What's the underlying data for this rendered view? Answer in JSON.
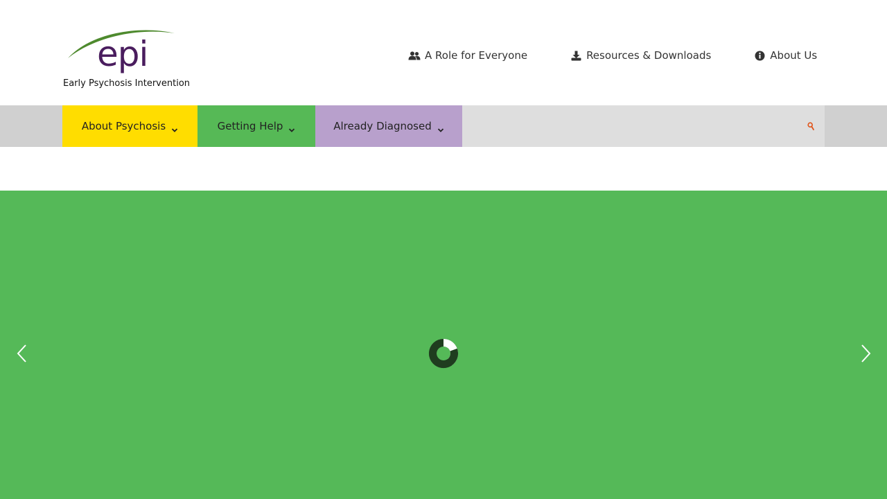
{
  "brand": {
    "logo_text": "epi",
    "tagline": "Early Psychosis Intervention",
    "logo_color": "#4a1d5e",
    "swoosh_color": "#4e8a2e"
  },
  "top_links": [
    {
      "label": "A Role for Everyone",
      "icon": "users-icon"
    },
    {
      "label": "Resources & Downloads",
      "icon": "download-icon"
    },
    {
      "label": "About Us",
      "icon": "info-icon"
    }
  ],
  "nav": {
    "items": [
      {
        "label": "About Psychosis",
        "color": "#ffdd00"
      },
      {
        "label": "Getting Help",
        "color": "#56b956"
      },
      {
        "label": "Already Diagnosed",
        "color": "#b8a0cc"
      }
    ],
    "search_icon": "search-icon",
    "search_color": "#e0541a"
  },
  "hero": {
    "background": "#55b958",
    "state": "loading",
    "prev_icon": "chevron-left-icon",
    "next_icon": "chevron-right-icon"
  }
}
